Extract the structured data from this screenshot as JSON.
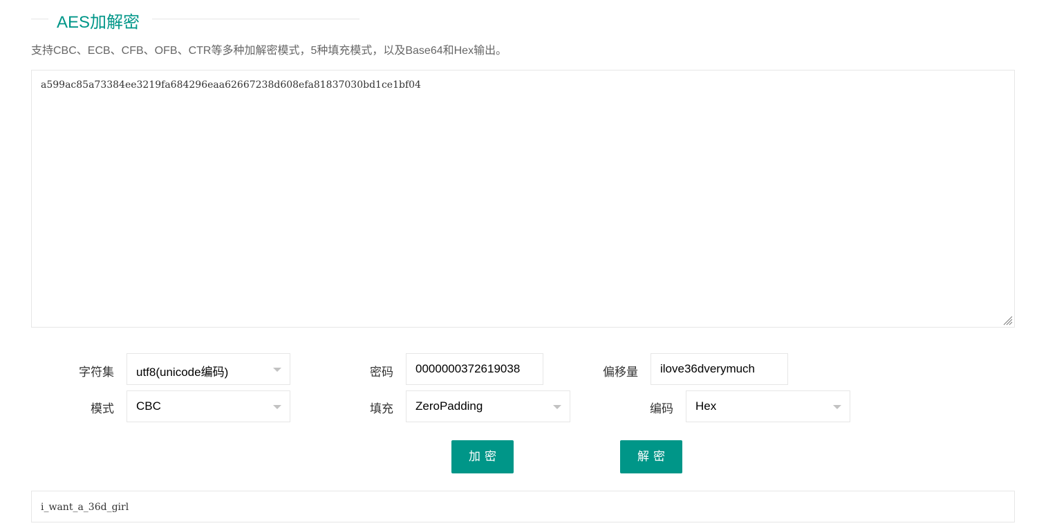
{
  "header": {
    "title": "AES加解密",
    "description": "支持CBC、ECB、CFB、OFB、CTR等多种加解密模式，5种填充模式，以及Base64和Hex输出。"
  },
  "input": {
    "value": "a599ac85a73384ee3219fa684296eaa62667238d608efa81837030bd1ce1bf04"
  },
  "options": {
    "charset": {
      "label": "字符集",
      "value": "utf8(unicode编码)"
    },
    "password": {
      "label": "密码",
      "value": "0000000372619038"
    },
    "offset": {
      "label": "偏移量",
      "value": "ilove36dverymuch"
    },
    "mode": {
      "label": "模式",
      "value": "CBC"
    },
    "padding": {
      "label": "填充",
      "value": "ZeroPadding"
    },
    "encoding": {
      "label": "编码",
      "value": "Hex"
    }
  },
  "buttons": {
    "encrypt": "加密",
    "decrypt": "解密"
  },
  "output": {
    "value": "i_want_a_36d_girl"
  },
  "colors": {
    "accent": "#009688",
    "border": "#e6e6e6",
    "muted_text": "#666666"
  }
}
